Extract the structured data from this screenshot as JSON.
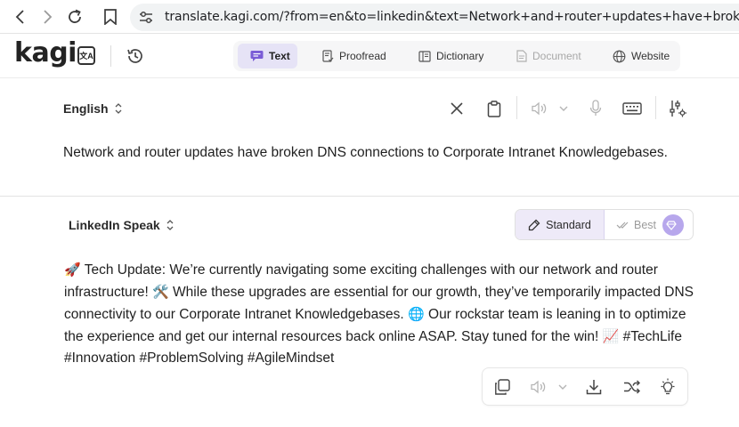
{
  "browser": {
    "url": "translate.kagi.com/?from=en&to=linkedin&text=Network+and+router+updates+have+broken+DNS+co"
  },
  "header": {
    "logo": "kagi",
    "logo_badge": "文A",
    "tabs": [
      {
        "label": "Text",
        "icon": "chat-icon",
        "state": "active"
      },
      {
        "label": "Proofread",
        "icon": "proofread-icon",
        "state": "normal"
      },
      {
        "label": "Dictionary",
        "icon": "book-icon",
        "state": "normal"
      },
      {
        "label": "Document",
        "icon": "document-icon",
        "state": "disabled"
      },
      {
        "label": "Website",
        "icon": "globe-icon",
        "state": "normal"
      }
    ]
  },
  "source": {
    "language": "English",
    "text": "Network and router updates have broken DNS connections to Corporate Intranet Knowledgebases.",
    "tools": [
      "close-icon",
      "clipboard-icon",
      "speaker-icon",
      "chevron-down-icon",
      "microphone-icon",
      "keyboard-icon",
      "settings-sliders-icon"
    ]
  },
  "target": {
    "language": "LinkedIn Speak",
    "quality": {
      "standard_label": "Standard",
      "best_label": "Best",
      "selected": "Standard"
    },
    "emoji": {
      "rocket": "🚀",
      "tools": "🛠️",
      "globe": "🌐",
      "chart": "📈"
    },
    "text_parts": {
      "p1": " Tech Update: We’re currently navigating some exciting challenges with our network and router infrastructure! ",
      "p2": " While these upgrades are essential for our growth, they’ve temporarily impacted DNS connectivity to our Corporate Intranet Knowledgebases. ",
      "p3": " Our rockstar team is leaning in to optimize the experience and get our internal resources back online ASAP. Stay tuned for the win! ",
      "p4": " #TechLife #Innovation #ProblemSolving #AgileMindset"
    },
    "tools": [
      "copy-icon",
      "speaker-icon",
      "chevron-down-icon",
      "download-icon",
      "shuffle-icon",
      "lightbulb-icon"
    ]
  },
  "colors": {
    "active_tab_bg": "#e6e3f6",
    "standard_bg": "#eeeaf8",
    "gem_bg": "#b7a7ec"
  }
}
